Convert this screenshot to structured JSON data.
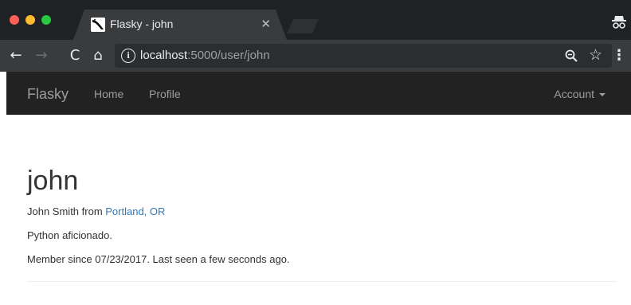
{
  "browser": {
    "tab": {
      "title": "Flasky - john",
      "close_glyph": "✕"
    },
    "url": {
      "host": "localhost",
      "rest": ":5000/user/john"
    },
    "icons": {
      "back": "←",
      "forward": "→",
      "reload": "C",
      "home": "⌂",
      "info": "i",
      "star": "☆",
      "menu": "⋮"
    }
  },
  "navbar": {
    "brand": "Flasky",
    "links": [
      "Home",
      "Profile"
    ],
    "account": "Account"
  },
  "profile": {
    "username": "john",
    "name_prefix": "John Smith from ",
    "location": "Portland, OR",
    "about": "Python aficionado.",
    "member_info": "Member since 07/23/2017. Last seen a few seconds ago."
  },
  "colors": {
    "titlebar": "#202124",
    "toolbar": "#3a3b3d",
    "navbar": "#222222",
    "link": "#337ab7"
  }
}
